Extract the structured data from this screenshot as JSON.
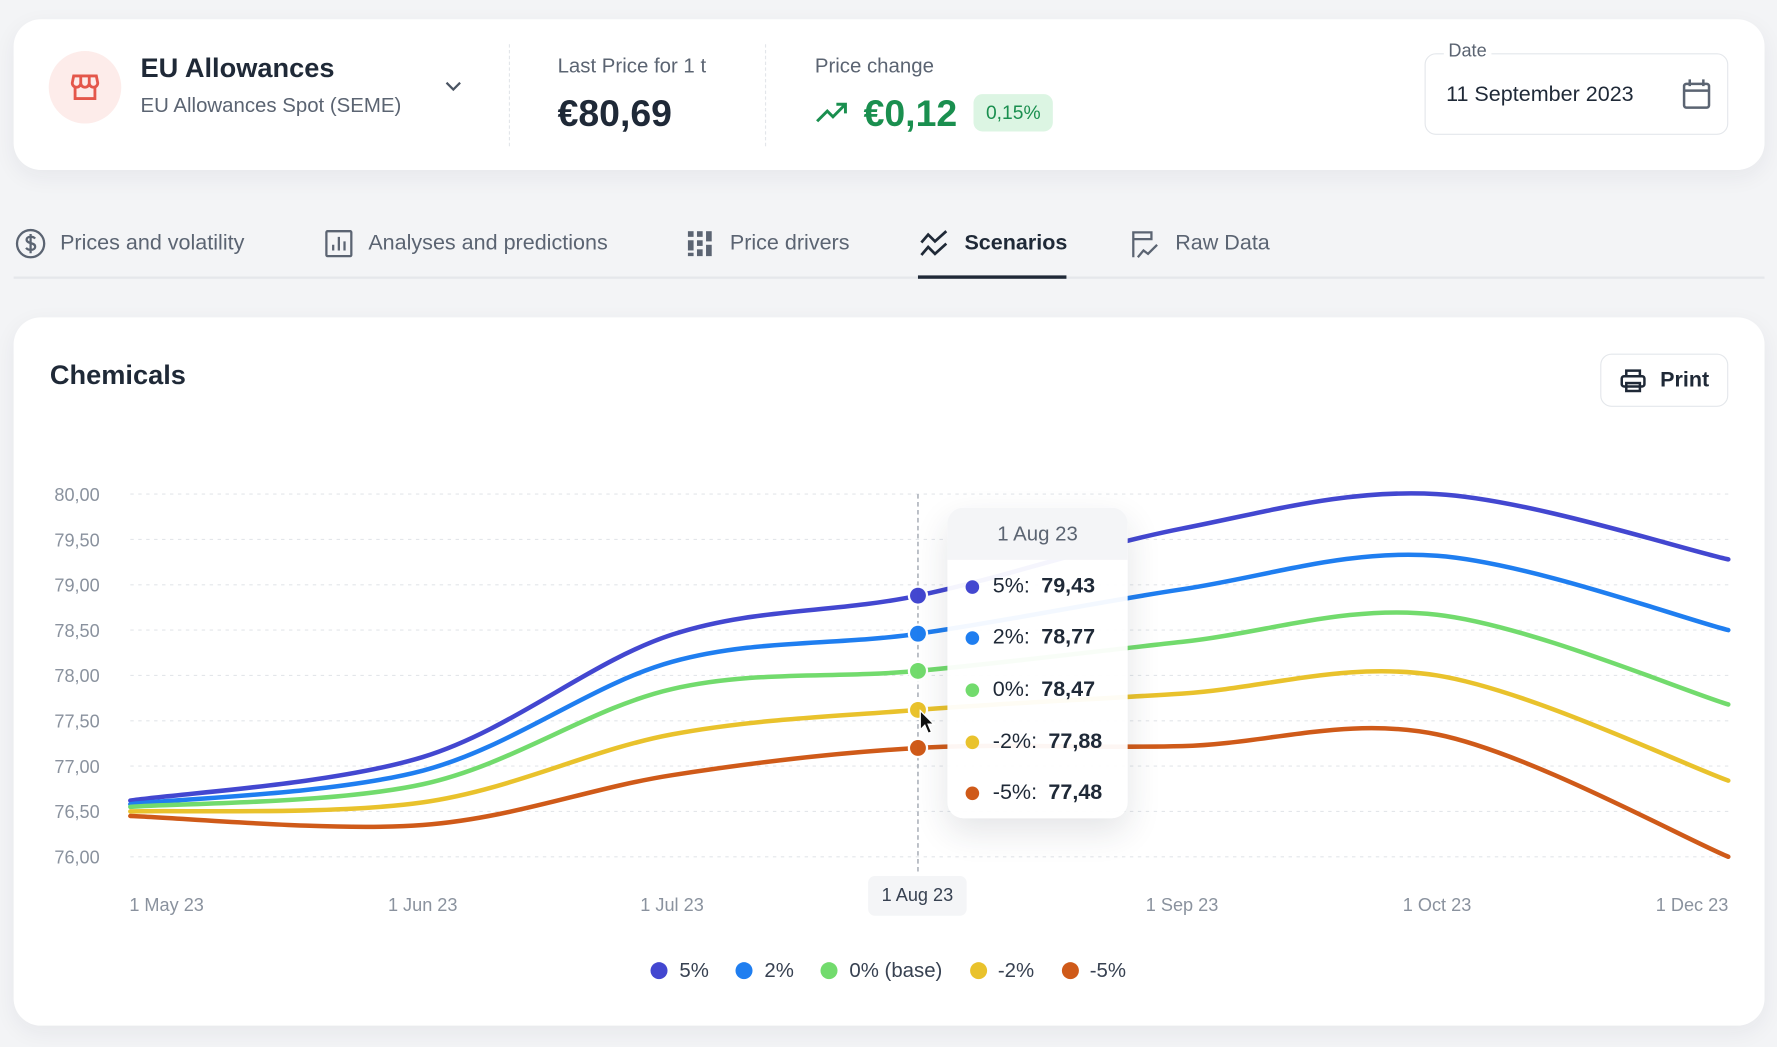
{
  "header": {
    "instrument_title": "EU Allowances",
    "instrument_subtitle": "EU Allowances Spot (SEME)",
    "instrument_icon": "store-icon",
    "last_price_label": "Last Price for 1 t",
    "last_price_value": "€80,69",
    "price_change_label": "Price change",
    "price_change_value": "€0,12",
    "price_change_percent": "0,15%",
    "date_label": "Date",
    "date_value": "11 September 2023"
  },
  "tabs": [
    {
      "label": "Prices and volatility",
      "icon": "dollar-circle-icon",
      "active": false
    },
    {
      "label": "Analyses and predictions",
      "icon": "bar-chart-icon",
      "active": false
    },
    {
      "label": "Price drivers",
      "icon": "grid-icon",
      "active": false
    },
    {
      "label": "Scenarios",
      "icon": "scenarios-icon",
      "active": true
    },
    {
      "label": "Raw Data",
      "icon": "raw-data-icon",
      "active": false
    }
  ],
  "panel": {
    "title": "Chemicals",
    "print_label": "Print"
  },
  "colors": {
    "accent_green": "#1a8f4f",
    "badge_bg": "#dcf5e3",
    "icon_red": "#e4574b"
  },
  "chart_data": {
    "type": "line",
    "x": [
      "1 May 23",
      "1 Jun 23",
      "1 Jul 23",
      "1 Aug 23",
      "1 Sep 23",
      "1 Oct 23",
      "1 Dec 23"
    ],
    "xtick_labels": [
      "1 May 23",
      "1 Jun 23",
      "1 Jul 23",
      "1 Aug 23",
      "1 Sep 23",
      "1 Oct 23",
      "1 Dec 23"
    ],
    "ytick_labels": [
      "80,00",
      "79,50",
      "79,00",
      "78,50",
      "78,00",
      "77,50",
      "77,00",
      "76,50",
      "76,00"
    ],
    "ylim": [
      76,
      80
    ],
    "grid": true,
    "legend_placement": "bottom",
    "series": [
      {
        "name": "5%",
        "color": "#4347d0",
        "values": [
          76.62,
          77.1,
          78.45,
          78.88,
          79.62,
          80.0,
          79.28
        ]
      },
      {
        "name": "2%",
        "color": "#1f7ef0",
        "values": [
          76.58,
          76.95,
          78.15,
          78.46,
          78.95,
          79.32,
          78.5
        ]
      },
      {
        "name": "0% (base)",
        "color": "#72db6d",
        "values": [
          76.55,
          76.8,
          77.85,
          78.05,
          78.37,
          78.67,
          77.68
        ]
      },
      {
        "name": "-2%",
        "color": "#e9c22c",
        "values": [
          76.5,
          76.6,
          77.35,
          77.62,
          77.8,
          78.0,
          76.84
        ]
      },
      {
        "name": "-5%",
        "color": "#cf5a19",
        "values": [
          76.45,
          76.35,
          76.9,
          77.2,
          77.22,
          77.35,
          76.0
        ]
      }
    ],
    "hover_index": 3,
    "tooltip": {
      "title": "1 Aug 23",
      "rows": [
        {
          "label": "5%:",
          "value": "79,43",
          "color": "#4347d0"
        },
        {
          "label": "2%:",
          "value": "78,77",
          "color": "#1f7ef0"
        },
        {
          "label": "0%:",
          "value": "78,47",
          "color": "#72db6d"
        },
        {
          "label": "-2%:",
          "value": "77,88",
          "color": "#e9c22c"
        },
        {
          "label": "-5%:",
          "value": "77,48",
          "color": "#cf5a19"
        }
      ]
    },
    "crosshair_label": "1 Aug 23"
  }
}
